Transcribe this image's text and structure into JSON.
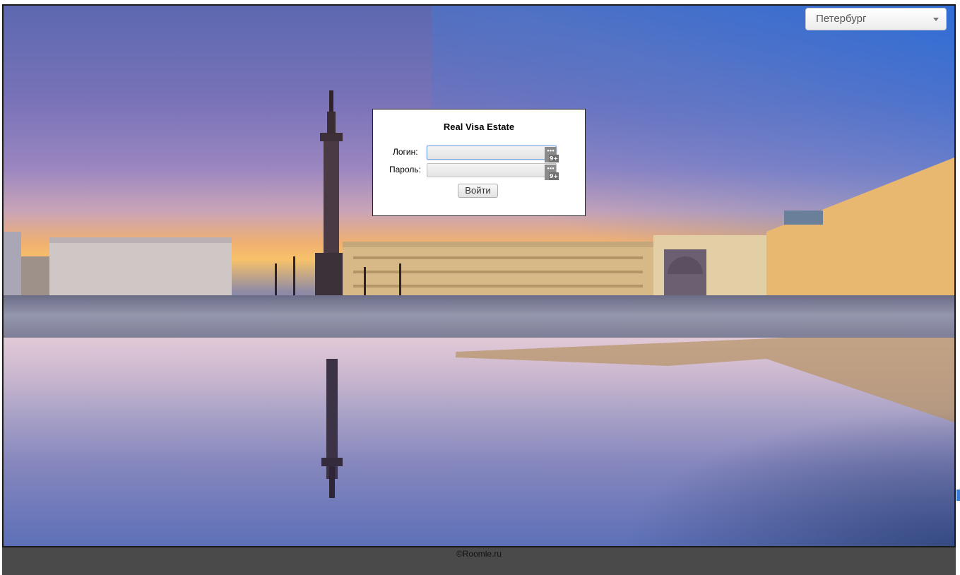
{
  "city_selector": {
    "selected": "Петербург"
  },
  "login": {
    "title": "Real Visa Estate",
    "login_label": "Логин:",
    "password_label": "Пароль:",
    "login_value": "",
    "password_value": "",
    "submit_label": "Войти",
    "password_manager_badge": "9+"
  },
  "footer": {
    "copyright": "©Roomle.ru"
  },
  "colors": {
    "footer_bg": "#4a4a4a",
    "dialog_border": "#222222"
  }
}
